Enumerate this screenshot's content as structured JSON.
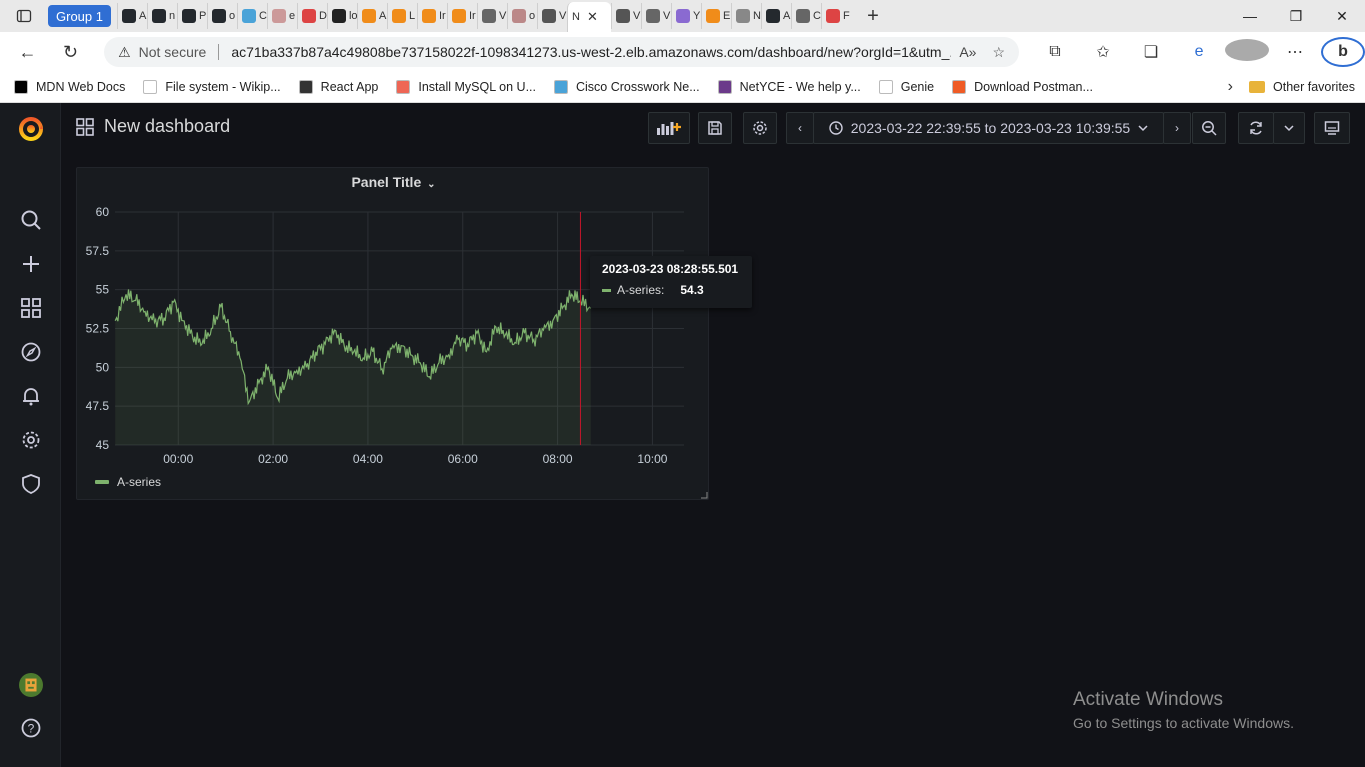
{
  "browser": {
    "tab_group": "Group 1",
    "tabs": [
      {
        "short": "A",
        "icon": "github-icon",
        "color": "#24292e"
      },
      {
        "short": "n",
        "icon": "github-icon",
        "color": "#24292e"
      },
      {
        "short": "P",
        "icon": "github-icon",
        "color": "#24292e"
      },
      {
        "short": "o",
        "icon": "github-icon",
        "color": "#24292e"
      },
      {
        "short": "C",
        "icon": "cisco-icon",
        "color": "#4aa3d8"
      },
      {
        "short": "e",
        "icon": "avatar-icon",
        "color": "#c99"
      },
      {
        "short": "D",
        "icon": "gmail-icon",
        "color": "#d44"
      },
      {
        "short": "lo",
        "icon": "docker-icon",
        "color": "#222"
      },
      {
        "short": "A",
        "icon": "aws-icon",
        "color": "#f08c1a"
      },
      {
        "short": "L",
        "icon": "aws-icon",
        "color": "#f08c1a"
      },
      {
        "short": "Ir",
        "icon": "aws-icon",
        "color": "#f08c1a"
      },
      {
        "short": "Ir",
        "icon": "aws-icon",
        "color": "#f08c1a"
      },
      {
        "short": "V",
        "icon": "page-icon",
        "color": "#666"
      },
      {
        "short": "o",
        "icon": "avatar-icon",
        "color": "#b88"
      },
      {
        "short": "V",
        "icon": "link-icon",
        "color": "#555"
      }
    ],
    "active_tab": {
      "short": "N",
      "icon": "grafana-icon"
    },
    "tabs_after": [
      {
        "short": "V",
        "icon": "link-icon",
        "color": "#555"
      },
      {
        "short": "V",
        "icon": "page-icon",
        "color": "#666"
      },
      {
        "short": "Y",
        "icon": "app-icon",
        "color": "#8a6ad1"
      },
      {
        "short": "E",
        "icon": "aws-icon",
        "color": "#f08c1a"
      },
      {
        "short": "N",
        "icon": "mail-icon",
        "color": "#888"
      },
      {
        "short": "A",
        "icon": "github-icon",
        "color": "#24292e"
      },
      {
        "short": "C",
        "icon": "page-icon",
        "color": "#666"
      },
      {
        "short": "F",
        "icon": "gmail-icon",
        "color": "#d44"
      }
    ],
    "security_label": "Not secure",
    "url": "ac71ba337b87a4c49808be737158022f-1098341273.us-west-2.elb.amazonaws.com/dashboard/new?orgId=1&utm_...",
    "bookmarks": [
      {
        "label": "MDN Web Docs",
        "icon": "mdn-icon",
        "color": "#000"
      },
      {
        "label": "File system - Wikip...",
        "icon": "wikipedia-icon",
        "color": "#fff"
      },
      {
        "label": "React App",
        "icon": "react-icon",
        "color": "#333"
      },
      {
        "label": "Install MySQL on U...",
        "icon": "bookmark-icon",
        "color": "#e65"
      },
      {
        "label": "Cisco Crosswork Ne...",
        "icon": "cisco-icon",
        "color": "#4aa3d8"
      },
      {
        "label": "NetYCE - We help y...",
        "icon": "netyce-icon",
        "color": "#6b3a8a"
      },
      {
        "label": "Genie",
        "icon": "page-icon",
        "color": "#fff"
      },
      {
        "label": "Download Postman...",
        "icon": "postman-icon",
        "color": "#ef5b25"
      }
    ],
    "other_favorites": "Other favorites"
  },
  "dashboard": {
    "title": "New dashboard",
    "time_range": "2023-03-22 22:39:55 to 2023-03-23 10:39:55"
  },
  "panel": {
    "title": "Panel Title",
    "tooltip": {
      "time": "2023-03-23 08:28:55.501",
      "series": "A-series:",
      "value": "54.3"
    }
  },
  "chart_data": {
    "type": "line",
    "title": "Panel Title",
    "x_tick_labels": [
      "00:00",
      "02:00",
      "04:00",
      "06:00",
      "08:00",
      "10:00"
    ],
    "y_tick_labels": [
      "60",
      "57.5",
      "55",
      "52.5",
      "50",
      "47.5",
      "45"
    ],
    "ylim": [
      45,
      60
    ],
    "xlim_hours": [
      22.666,
      34.666
    ],
    "grid": true,
    "legend": "bottom-left",
    "series": [
      {
        "name": "A-series",
        "color": "#7eb26d",
        "x_hours": [
          22.67,
          22.9,
          23.1,
          23.3,
          23.5,
          23.7,
          23.9,
          24.1,
          24.3,
          24.5,
          24.7,
          24.9,
          25.1,
          25.3,
          25.5,
          25.7,
          25.9,
          26.1,
          26.3,
          26.5,
          26.7,
          26.9,
          27.1,
          27.3,
          27.5,
          27.7,
          27.9,
          28.1,
          28.3,
          28.5,
          28.7,
          28.9,
          29.1,
          29.3,
          29.5,
          29.7,
          29.9,
          30.1,
          30.3,
          30.5,
          30.7,
          30.9,
          31.1,
          31.3,
          31.5,
          31.7,
          31.9,
          32.1,
          32.3,
          32.48,
          32.7
        ],
        "values": [
          53.0,
          54.7,
          54.3,
          53.6,
          52.9,
          53.2,
          54.2,
          53.0,
          52.0,
          51.5,
          52.5,
          53.9,
          52.3,
          50.6,
          47.8,
          49.0,
          50.0,
          48.0,
          49.3,
          49.8,
          50.0,
          51.0,
          51.5,
          52.4,
          51.4,
          51.0,
          50.6,
          51.0,
          49.9,
          51.2,
          51.4,
          50.8,
          50.3,
          49.4,
          50.3,
          50.8,
          51.8,
          51.5,
          52.2,
          51.0,
          52.6,
          52.1,
          51.6,
          52.2,
          51.8,
          52.4,
          53.0,
          53.8,
          54.7,
          54.3,
          53.8
        ]
      }
    ]
  },
  "watermark": {
    "line1": "Activate Windows",
    "line2": "Go to Settings to activate Windows."
  }
}
